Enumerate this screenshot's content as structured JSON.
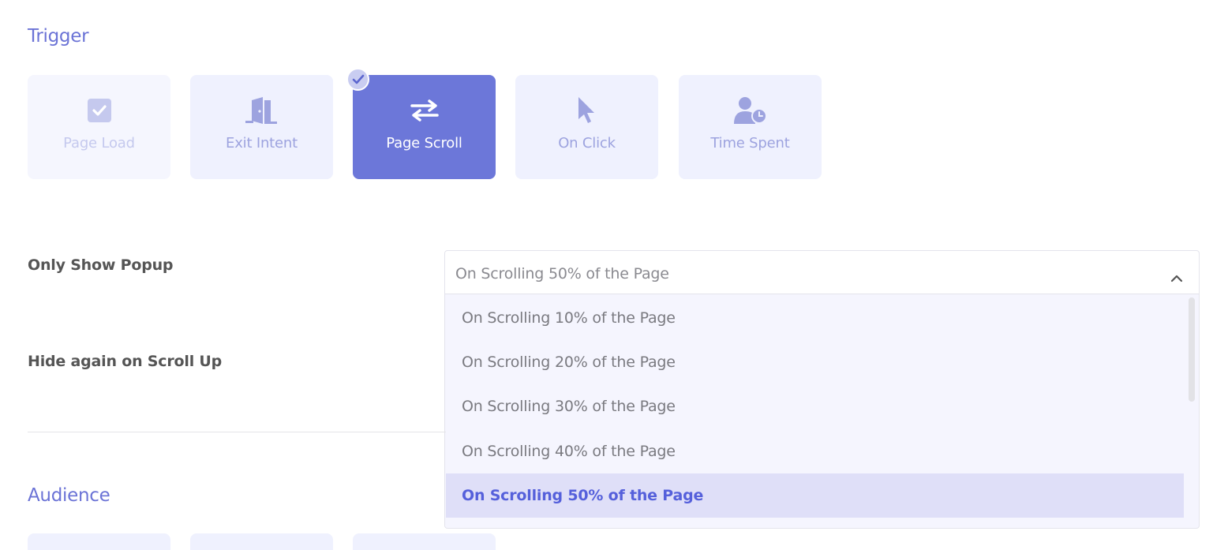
{
  "trigger": {
    "title": "Trigger",
    "cards": [
      {
        "label": "Page Load",
        "icon": "checkbox-icon"
      },
      {
        "label": "Exit Intent",
        "icon": "door-icon"
      },
      {
        "label": "Page Scroll",
        "icon": "exchange-arrows-icon",
        "selected": true
      },
      {
        "label": "On Click",
        "icon": "cursor-icon"
      },
      {
        "label": "Time Spent",
        "icon": "user-clock-icon"
      }
    ]
  },
  "only_show_popup": {
    "label": "Only Show Popup",
    "selected_value": "On Scrolling 50% of the Page",
    "options": [
      "On Scrolling 10% of the Page",
      "On Scrolling 20% of the Page",
      "On Scrolling 30% of the Page",
      "On Scrolling 40% of the Page",
      "On Scrolling 50% of the Page"
    ]
  },
  "hide_again": {
    "label": "Hide again on Scroll Up"
  },
  "audience": {
    "title": "Audience"
  },
  "colors": {
    "accent": "#6c77d9",
    "card_bg": "#eff1fe",
    "highlight": "#dfdff8"
  }
}
